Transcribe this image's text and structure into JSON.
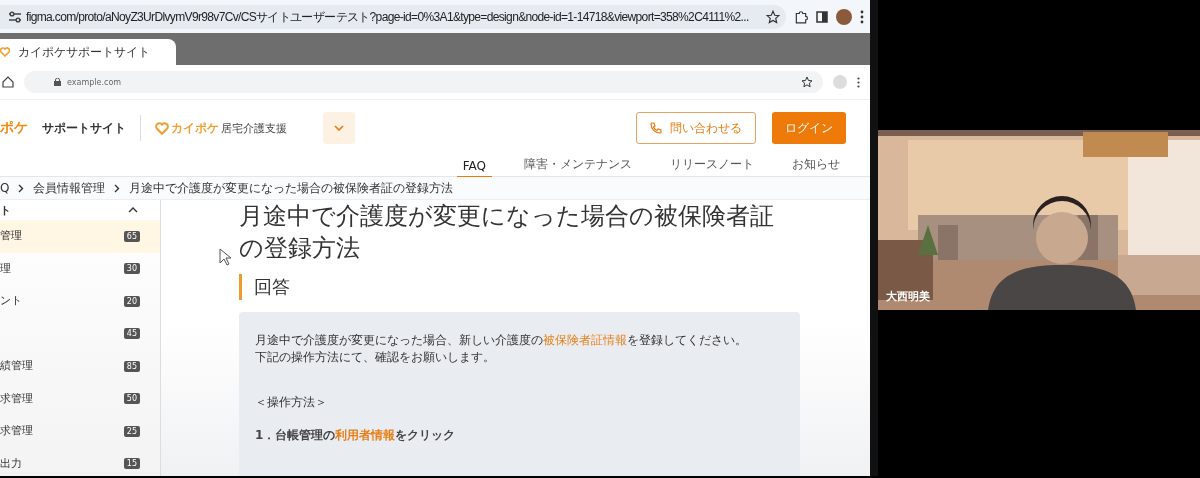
{
  "browser": {
    "url": "figma.com/proto/aNoyZ3UrDlvymV9r98v7Cv/CSサイトユーザーテスト?page-id=0%3A1&type=design&node-id=1-14718&viewport=358%2C4111%2...",
    "tab_title": "カイポケサポートサイト",
    "inner_url": "example.com"
  },
  "header": {
    "logo_text": "ポケ",
    "site_name": "サポートサイト",
    "brand": "カイポケ",
    "brand_sub": "居宅介護支援",
    "contact_button": "問い合わせる",
    "login_button": "ログイン",
    "nav": [
      {
        "label": "FAQ",
        "selected": true
      },
      {
        "label": "障害・メンテナンス",
        "selected": false
      },
      {
        "label": "リリースノート",
        "selected": false
      },
      {
        "label": "お知らせ",
        "selected": false
      }
    ]
  },
  "breadcrumb": [
    "Q",
    "会員情報管理",
    "月途中で介護度が変更になった場合の被保険者証の登録方法"
  ],
  "sidebar": {
    "title": "ト",
    "expanded": true,
    "items": [
      {
        "label": "管理",
        "count": "65",
        "selected": true
      },
      {
        "label": "理",
        "count": "30",
        "selected": false
      },
      {
        "label": "ント",
        "count": "20",
        "selected": false
      },
      {
        "count": "45",
        "selected": false
      },
      {
        "label": "績管理",
        "count": "85",
        "selected": false
      },
      {
        "label": "求管理",
        "count": "50",
        "selected": false
      },
      {
        "label": "求管理",
        "count": "25",
        "selected": false
      },
      {
        "label": "出力",
        "count": "15",
        "selected": false
      }
    ]
  },
  "article": {
    "title_lines": [
      "月途中で介護度が変更になった場合の被保険者証",
      "の登録方法"
    ],
    "section": "回答",
    "paragraphs": [
      [
        {
          "kind": "text",
          "text": "月途中で介護度が変更になった場合、新しい介護度の"
        },
        {
          "kind": "link",
          "text": "被保険者証情報"
        },
        {
          "kind": "text",
          "text": "を登録してください。"
        }
      ],
      [
        {
          "kind": "text",
          "text": "下記の操作方法にて、確認をお願いします。"
        }
      ]
    ],
    "procedure_heading": "＜操作方法＞",
    "steps": [
      [
        {
          "kind": "text",
          "text": "1．台帳管理の"
        },
        {
          "kind": "link",
          "text": "利用者情報"
        },
        {
          "kind": "text",
          "text": "をクリック"
        }
      ]
    ]
  },
  "video": {
    "participant_name": "大西明美"
  }
}
